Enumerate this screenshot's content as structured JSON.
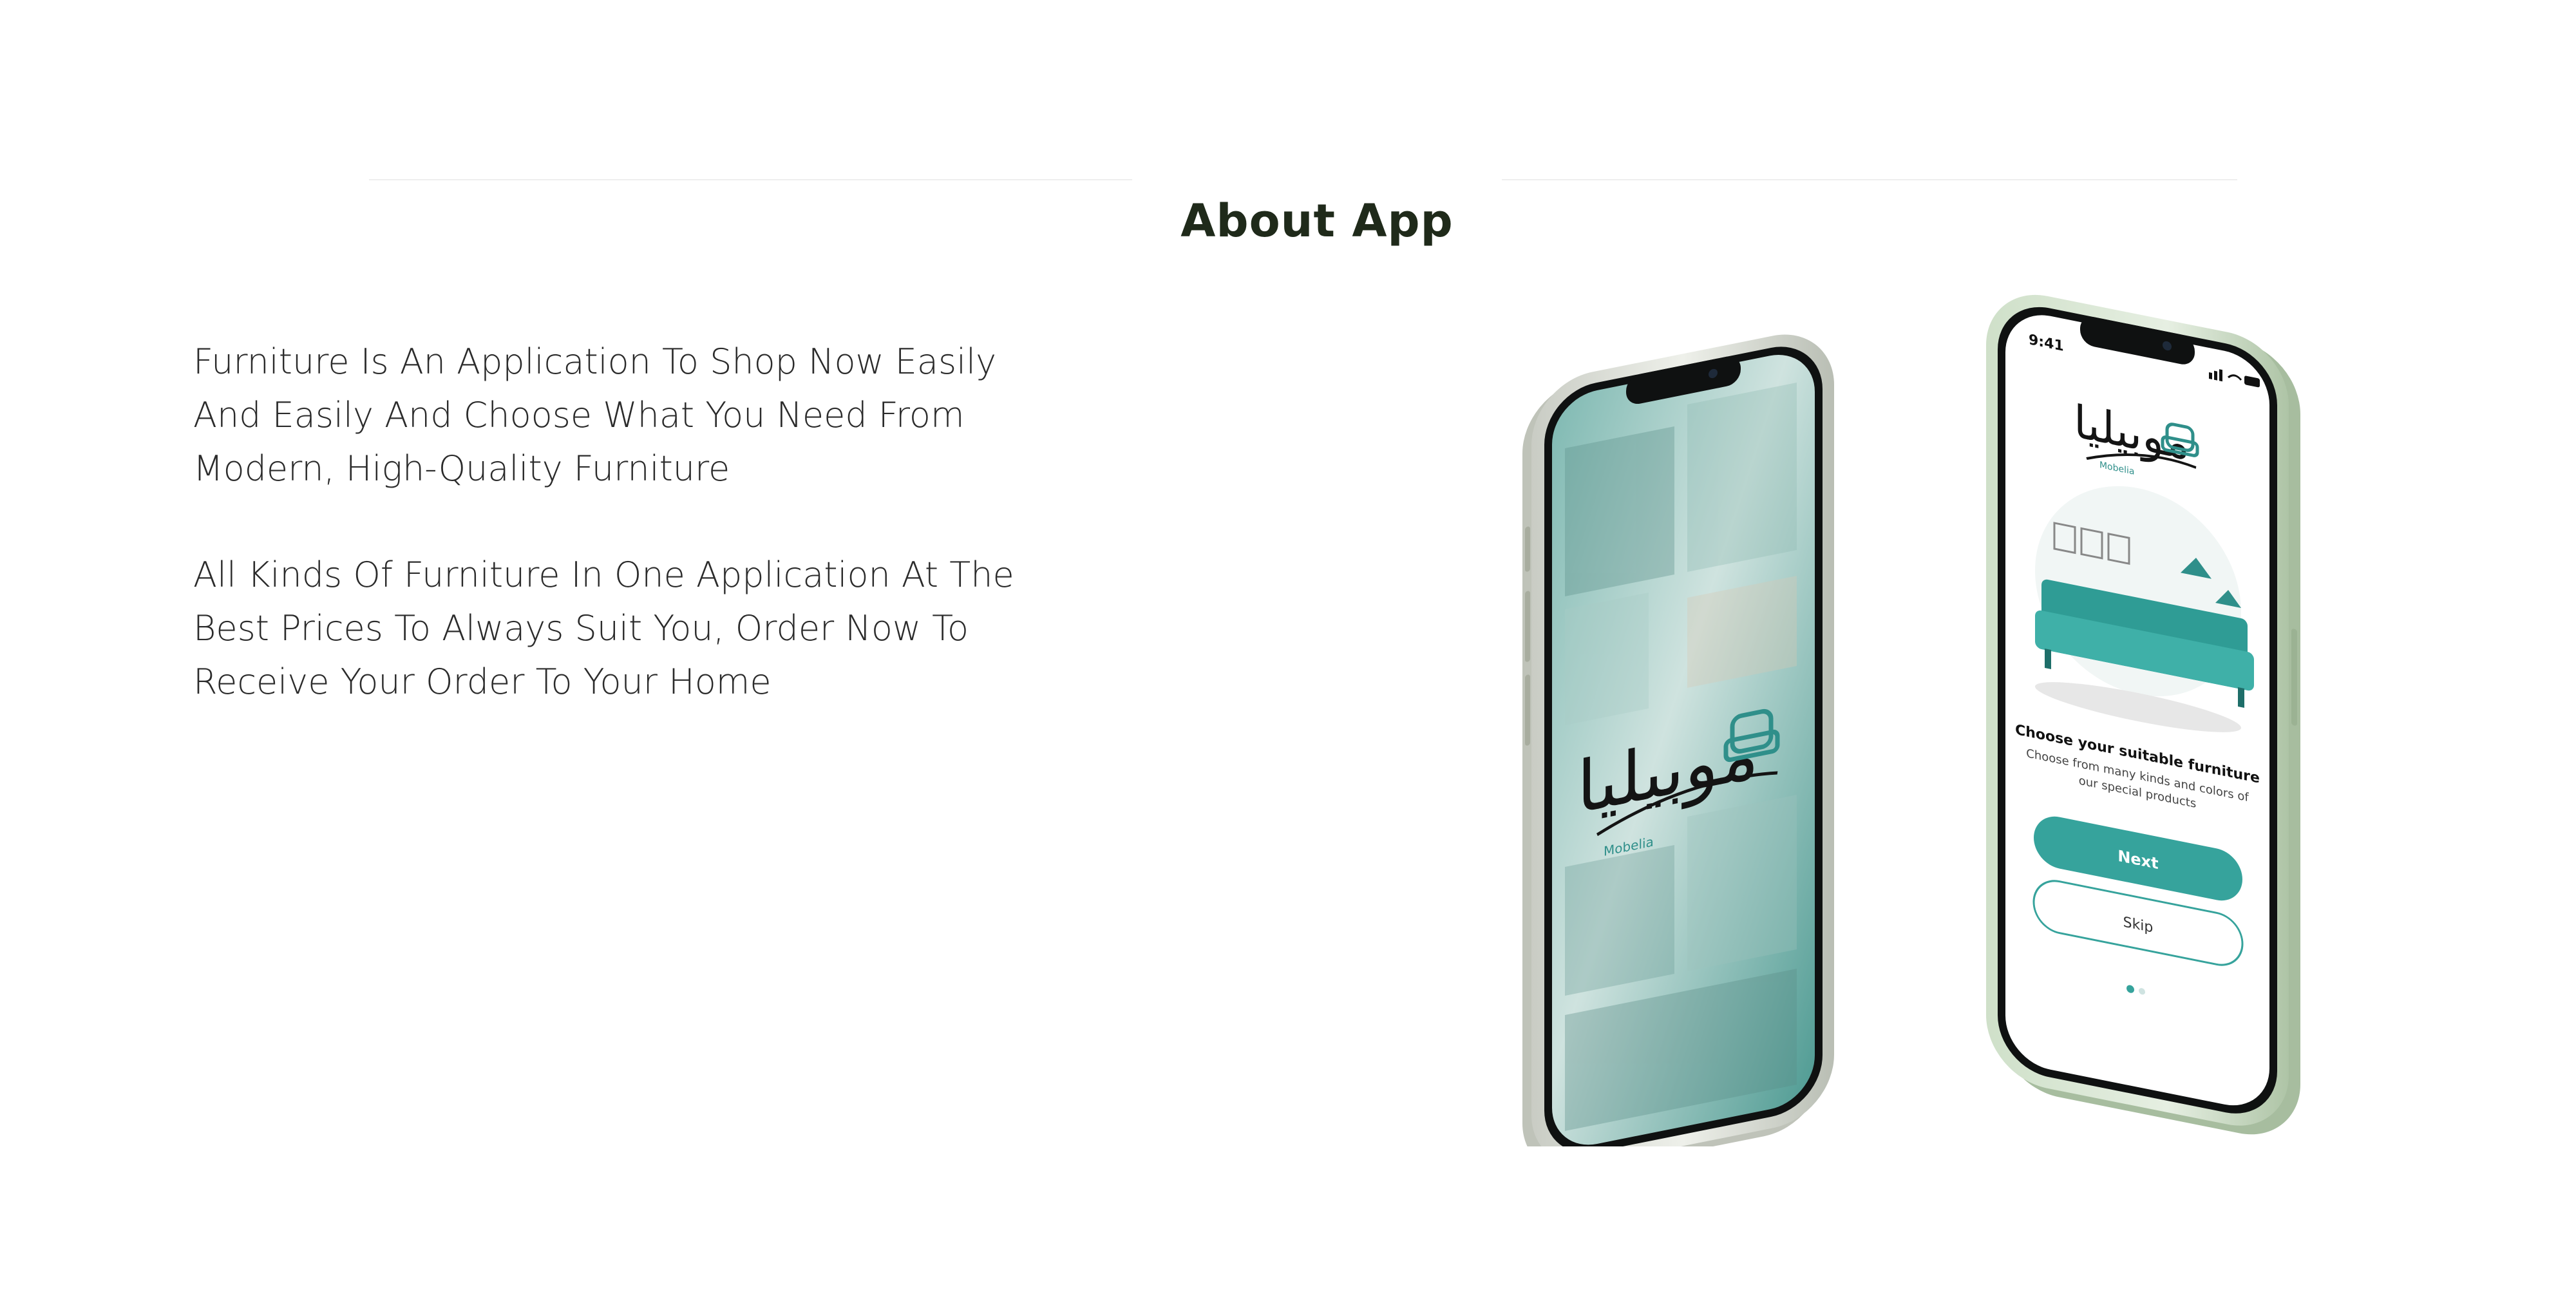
{
  "section": {
    "title": "About App"
  },
  "about": {
    "paragraphs": [
      "Furniture Is An Application To Shop Now Easily And Easily And Choose What You Need From Modern, High-Quality Furniture",
      "All Kinds Of Furniture In One Application At The Best Prices To Always Suit You, Order Now To Receive Your Order To Your Home"
    ]
  },
  "phones": {
    "splash": {
      "logo_arabic": "موبيليا",
      "logo_latin": "Mobelia"
    },
    "onboarding": {
      "status_time": "9:41",
      "logo_arabic": "موبيليا",
      "logo_latin": "Mobelia",
      "heading": "Choose your suitable furniture",
      "body_line1": "Choose from many kinds and colors of",
      "body_line2": "our special products",
      "next_label": "Next",
      "skip_label": "Skip"
    }
  },
  "colors": {
    "accent": "#3a9e9a",
    "frame": "#d9ddd6",
    "frame_green": "#c6d6c0",
    "title": "#1f2a1a",
    "text": "#2b2b2b"
  }
}
